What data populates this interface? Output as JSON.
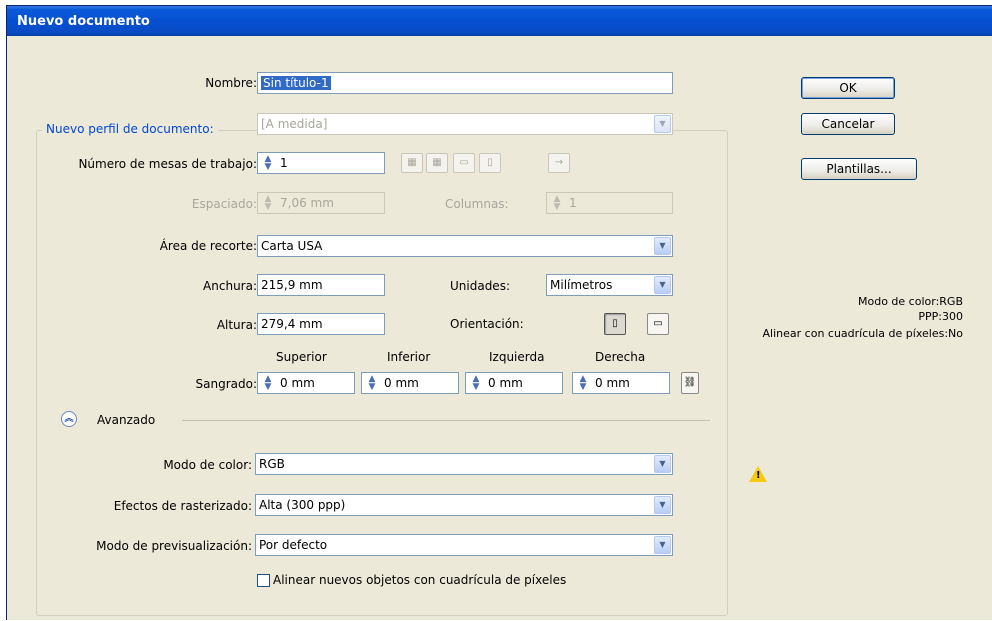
{
  "window": {
    "title": "Nuevo documento"
  },
  "name": {
    "label": "Nombre:",
    "value": "Sin título-1"
  },
  "profile": {
    "legend": "Nuevo perfil de documento:",
    "value": "[A medida]"
  },
  "artboards": {
    "label": "Número de mesas de trabajo:",
    "value": "1"
  },
  "spacing": {
    "label": "Espaciado:",
    "value": "7,06 mm"
  },
  "columns": {
    "label": "Columnas:",
    "value": "1"
  },
  "crop": {
    "label": "Área de recorte:",
    "value": "Carta USA"
  },
  "width": {
    "label": "Anchura:",
    "value": "215,9 mm"
  },
  "units": {
    "label": "Unidades:",
    "value": "Milímetros"
  },
  "height": {
    "label": "Altura:",
    "value": "279,4 mm"
  },
  "orientation": {
    "label": "Orientación:"
  },
  "bleed": {
    "label": "Sangrado:",
    "top_label": "Superior",
    "top_value": "0 mm",
    "bottom_label": "Inferior",
    "bottom_value": "0 mm",
    "left_label": "Izquierda",
    "left_value": "0 mm",
    "right_label": "Derecha",
    "right_value": "0 mm"
  },
  "advanced": {
    "label": "Avanzado"
  },
  "color_mode": {
    "label": "Modo de color:",
    "value": "RGB"
  },
  "raster": {
    "label": "Efectos de rasterizado:",
    "value": "Alta (300 ppp)"
  },
  "preview": {
    "label": "Modo de previsualización:",
    "value": "Por defecto"
  },
  "align_pixels": {
    "label": "Alinear nuevos objetos con cuadrícula de píxeles",
    "checked": false
  },
  "buttons": {
    "ok": "OK",
    "cancel": "Cancelar",
    "templates": "Plantillas..."
  },
  "info": {
    "color_mode": "Modo de color:RGB",
    "ppp": "PPP:300",
    "align": "Alinear con cuadrícula de píxeles:No"
  },
  "icons": {
    "spin": "spinner-arrows-icon",
    "dropdown": "chevron-down-icon",
    "advanced": "double-chevron-up-icon",
    "warning": "warning-icon",
    "link": "chain-link-icon"
  }
}
